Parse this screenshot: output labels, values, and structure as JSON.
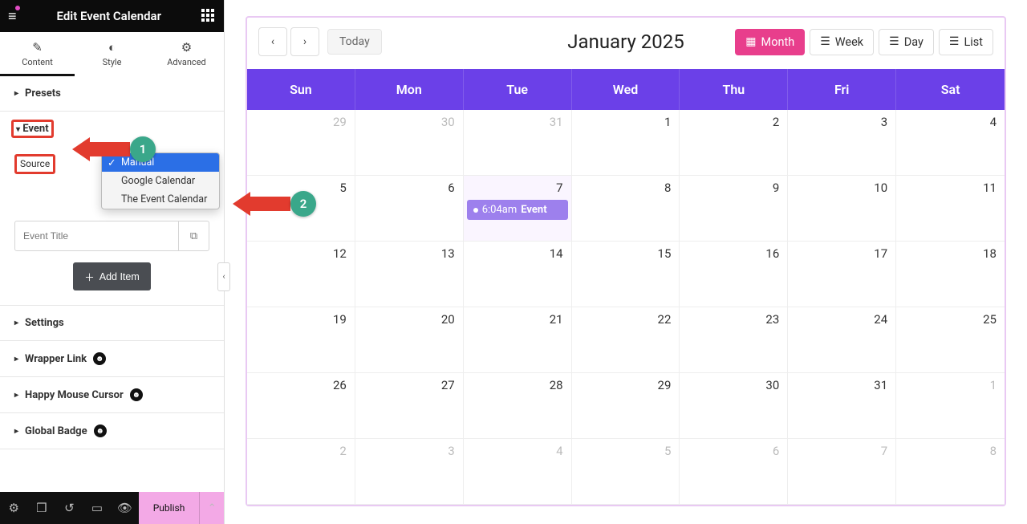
{
  "header": {
    "title": "Edit Event Calendar"
  },
  "tabs": {
    "content": "Content",
    "style": "Style",
    "advanced": "Advanced"
  },
  "sections": {
    "presets": "Presets",
    "event": "Event",
    "settings": "Settings",
    "wrapper": "Wrapper Link",
    "mouse": "Happy Mouse Cursor",
    "badge": "Global Badge"
  },
  "event_panel": {
    "source_label": "Source",
    "dropdown": [
      "Manual",
      "Google Calendar",
      "The Event Calendar"
    ],
    "title_placeholder": "Event Title",
    "add_item": "Add Item"
  },
  "bottom": {
    "publish": "Publish"
  },
  "annotations": {
    "badge1": "1",
    "badge2": "2"
  },
  "calendar": {
    "today": "Today",
    "title": "January 2025",
    "views": {
      "month": "Month",
      "week": "Week",
      "day": "Day",
      "list": "List"
    },
    "weekdays": [
      "Sun",
      "Mon",
      "Tue",
      "Wed",
      "Thu",
      "Fri",
      "Sat"
    ],
    "cells": [
      {
        "n": "29",
        "out": true
      },
      {
        "n": "30",
        "out": true
      },
      {
        "n": "31",
        "out": true
      },
      {
        "n": "1"
      },
      {
        "n": "2"
      },
      {
        "n": "3"
      },
      {
        "n": "4"
      },
      {
        "n": "5"
      },
      {
        "n": "6"
      },
      {
        "n": "7",
        "today": true,
        "event": {
          "time": "6:04am",
          "title": "Event"
        }
      },
      {
        "n": "8"
      },
      {
        "n": "9"
      },
      {
        "n": "10"
      },
      {
        "n": "11"
      },
      {
        "n": "12"
      },
      {
        "n": "13"
      },
      {
        "n": "14"
      },
      {
        "n": "15"
      },
      {
        "n": "16"
      },
      {
        "n": "17"
      },
      {
        "n": "18"
      },
      {
        "n": "19"
      },
      {
        "n": "20"
      },
      {
        "n": "21"
      },
      {
        "n": "22"
      },
      {
        "n": "23"
      },
      {
        "n": "24"
      },
      {
        "n": "25"
      },
      {
        "n": "26"
      },
      {
        "n": "27"
      },
      {
        "n": "28"
      },
      {
        "n": "29"
      },
      {
        "n": "30"
      },
      {
        "n": "31"
      },
      {
        "n": "1",
        "out": true
      },
      {
        "n": "2",
        "out": true
      },
      {
        "n": "3",
        "out": true
      },
      {
        "n": "4",
        "out": true
      },
      {
        "n": "5",
        "out": true
      },
      {
        "n": "6",
        "out": true
      },
      {
        "n": "7",
        "out": true
      },
      {
        "n": "8",
        "out": true
      }
    ]
  }
}
